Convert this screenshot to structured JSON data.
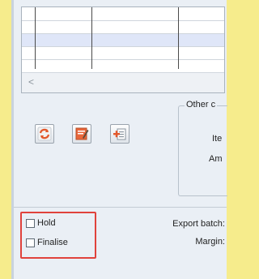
{
  "other_group": {
    "title": "Other c",
    "field1_label": "Ite",
    "field2_label": "Am"
  },
  "toolbar": {
    "refresh_icon": "refresh-icon",
    "edit_icon": "edit-icon",
    "add_icon": "add-icon"
  },
  "grid": {
    "scroll_left_glyph": "<"
  },
  "checkboxes": {
    "hold_label": "Hold",
    "finalise_label": "Finalise",
    "hold_checked": false,
    "finalise_checked": false
  },
  "bottom_fields": {
    "export_batch_label": "Export batch:",
    "margin_label": "Margin:"
  },
  "colors": {
    "highlight": "#e0423c",
    "selected_row": "#dfe6f8"
  }
}
